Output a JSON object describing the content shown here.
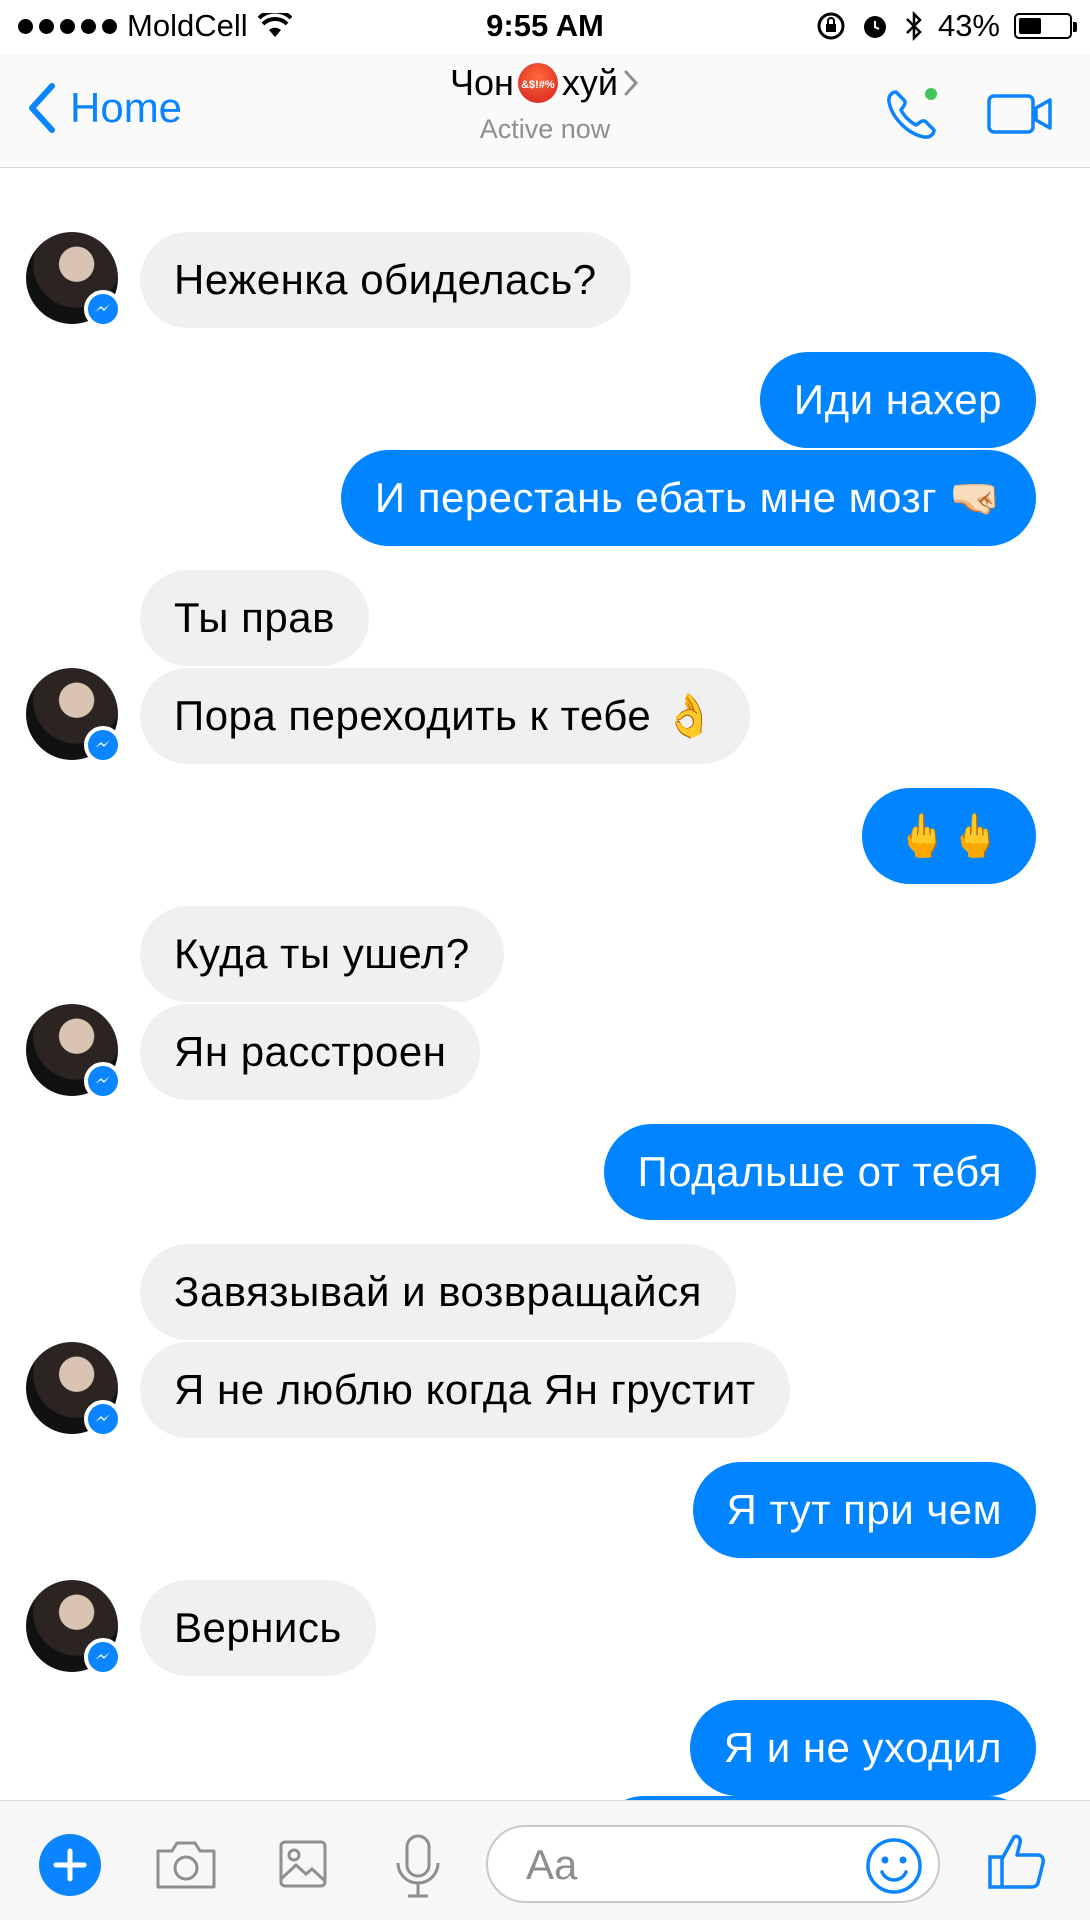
{
  "status_bar": {
    "carrier": "MoldCell",
    "time": "9:55 AM",
    "battery": "43%",
    "battery_level": 0.43
  },
  "header": {
    "back_label": "Home",
    "title_pre": "Чон",
    "title_emoji_text": "&$!#%",
    "title_post": "хуй",
    "subtitle": "Active now"
  },
  "messages": [
    {
      "side": "in",
      "text": "Неженка обиделась?"
    },
    {
      "side": "out",
      "text": "Иди нахер"
    },
    {
      "side": "out",
      "text": "И перестань ебать мне мозг 🤜🏻"
    },
    {
      "side": "in",
      "text": "Ты прав"
    },
    {
      "side": "in",
      "text": "Пора переходить к тебе 👌"
    },
    {
      "side": "out",
      "text": "🖕🖕"
    },
    {
      "side": "in",
      "text": "Куда ты ушел?"
    },
    {
      "side": "in",
      "text": "Ян расстроен"
    },
    {
      "side": "out",
      "text": "Подальше от тебя"
    },
    {
      "side": "in",
      "text": "Завязывай и возвращайся"
    },
    {
      "side": "in",
      "text": "Я не люблю когда Ян грустит"
    },
    {
      "side": "out",
      "text": "Я тут при чем"
    },
    {
      "side": "in",
      "text": "Вернись"
    },
    {
      "side": "out",
      "text": "Я и не уходил"
    }
  ],
  "composer": {
    "placeholder": "Aa"
  },
  "icons": [
    "plus-icon",
    "camera-icon",
    "image-icon",
    "microphone-icon",
    "emoji-icon",
    "thumbs-up-icon",
    "phone-icon",
    "video-icon",
    "chevron-left-icon",
    "chevron-right-icon",
    "wifi-icon",
    "messenger-badge-icon"
  ],
  "colors": {
    "accent": "#0084ff",
    "incoming_bubble": "#f1f0f0",
    "outgoing_bubble": "#0084ff"
  }
}
